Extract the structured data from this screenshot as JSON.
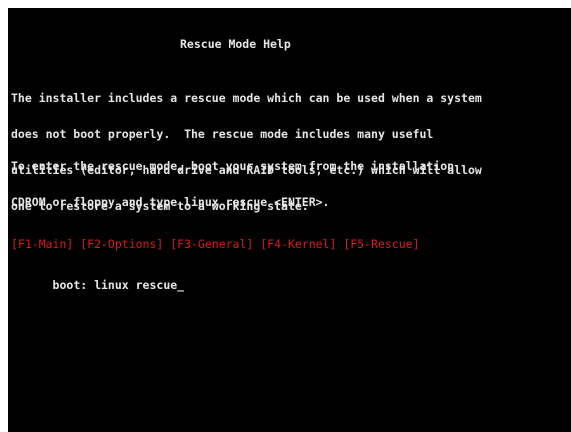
{
  "screen": {
    "title": "Rescue Mode Help",
    "paragraph1": [
      "The installer includes a rescue mode which can be used when a system",
      "does not boot properly.  The rescue mode includes many useful",
      "utilities (editor, hard drive and RAID tools, etc.) which will allow",
      "one to restore a system to a working state."
    ],
    "paragraph2": [
      "To enter the rescue mode, boot your system from the installation",
      "CDROM or floppy and type linux rescue <ENTER>."
    ],
    "function_keys": "[F1-Main] [F2-Options] [F3-General] [F4-Kernel] [F5-Rescue]",
    "boot_prompt": "boot: linux rescue",
    "cursor": "_"
  },
  "colors": {
    "background": "#000000",
    "text": "#e6e6e6",
    "function_keys": "#d81b1b",
    "frame": "#ffffff"
  }
}
